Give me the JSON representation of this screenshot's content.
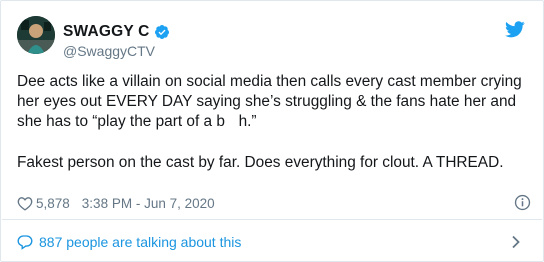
{
  "user": {
    "display_name": "SWAGGY C",
    "handle": "@SwaggyCTV",
    "verified": true,
    "avatar_icon": "avatar-image"
  },
  "tweet": {
    "paragraphs": [
      "Dee acts like a villain on social media then calls every cast member crying her eyes out EVERY DAY saying she’s struggling & the fans hate her and she has to “play the part of a b    h.”",
      "Fakest person on the cast by far. Does everything for clout. A THREAD."
    ]
  },
  "meta": {
    "likes": "5,878",
    "timestamp": "3:38 PM - Jun 7, 2020",
    "heart_icon": "heart-outline-icon",
    "info_icon": "info-icon"
  },
  "footer": {
    "talking_label": "887 people are talking about this",
    "bubble_icon": "speech-bubble-icon",
    "chevron_icon": "chevron-right-icon"
  },
  "colors": {
    "twitter_blue": "#1da1f2",
    "link_blue": "#1b95e0",
    "text_primary": "#14171a",
    "text_secondary": "#657786",
    "border": "#e1e8ed"
  }
}
